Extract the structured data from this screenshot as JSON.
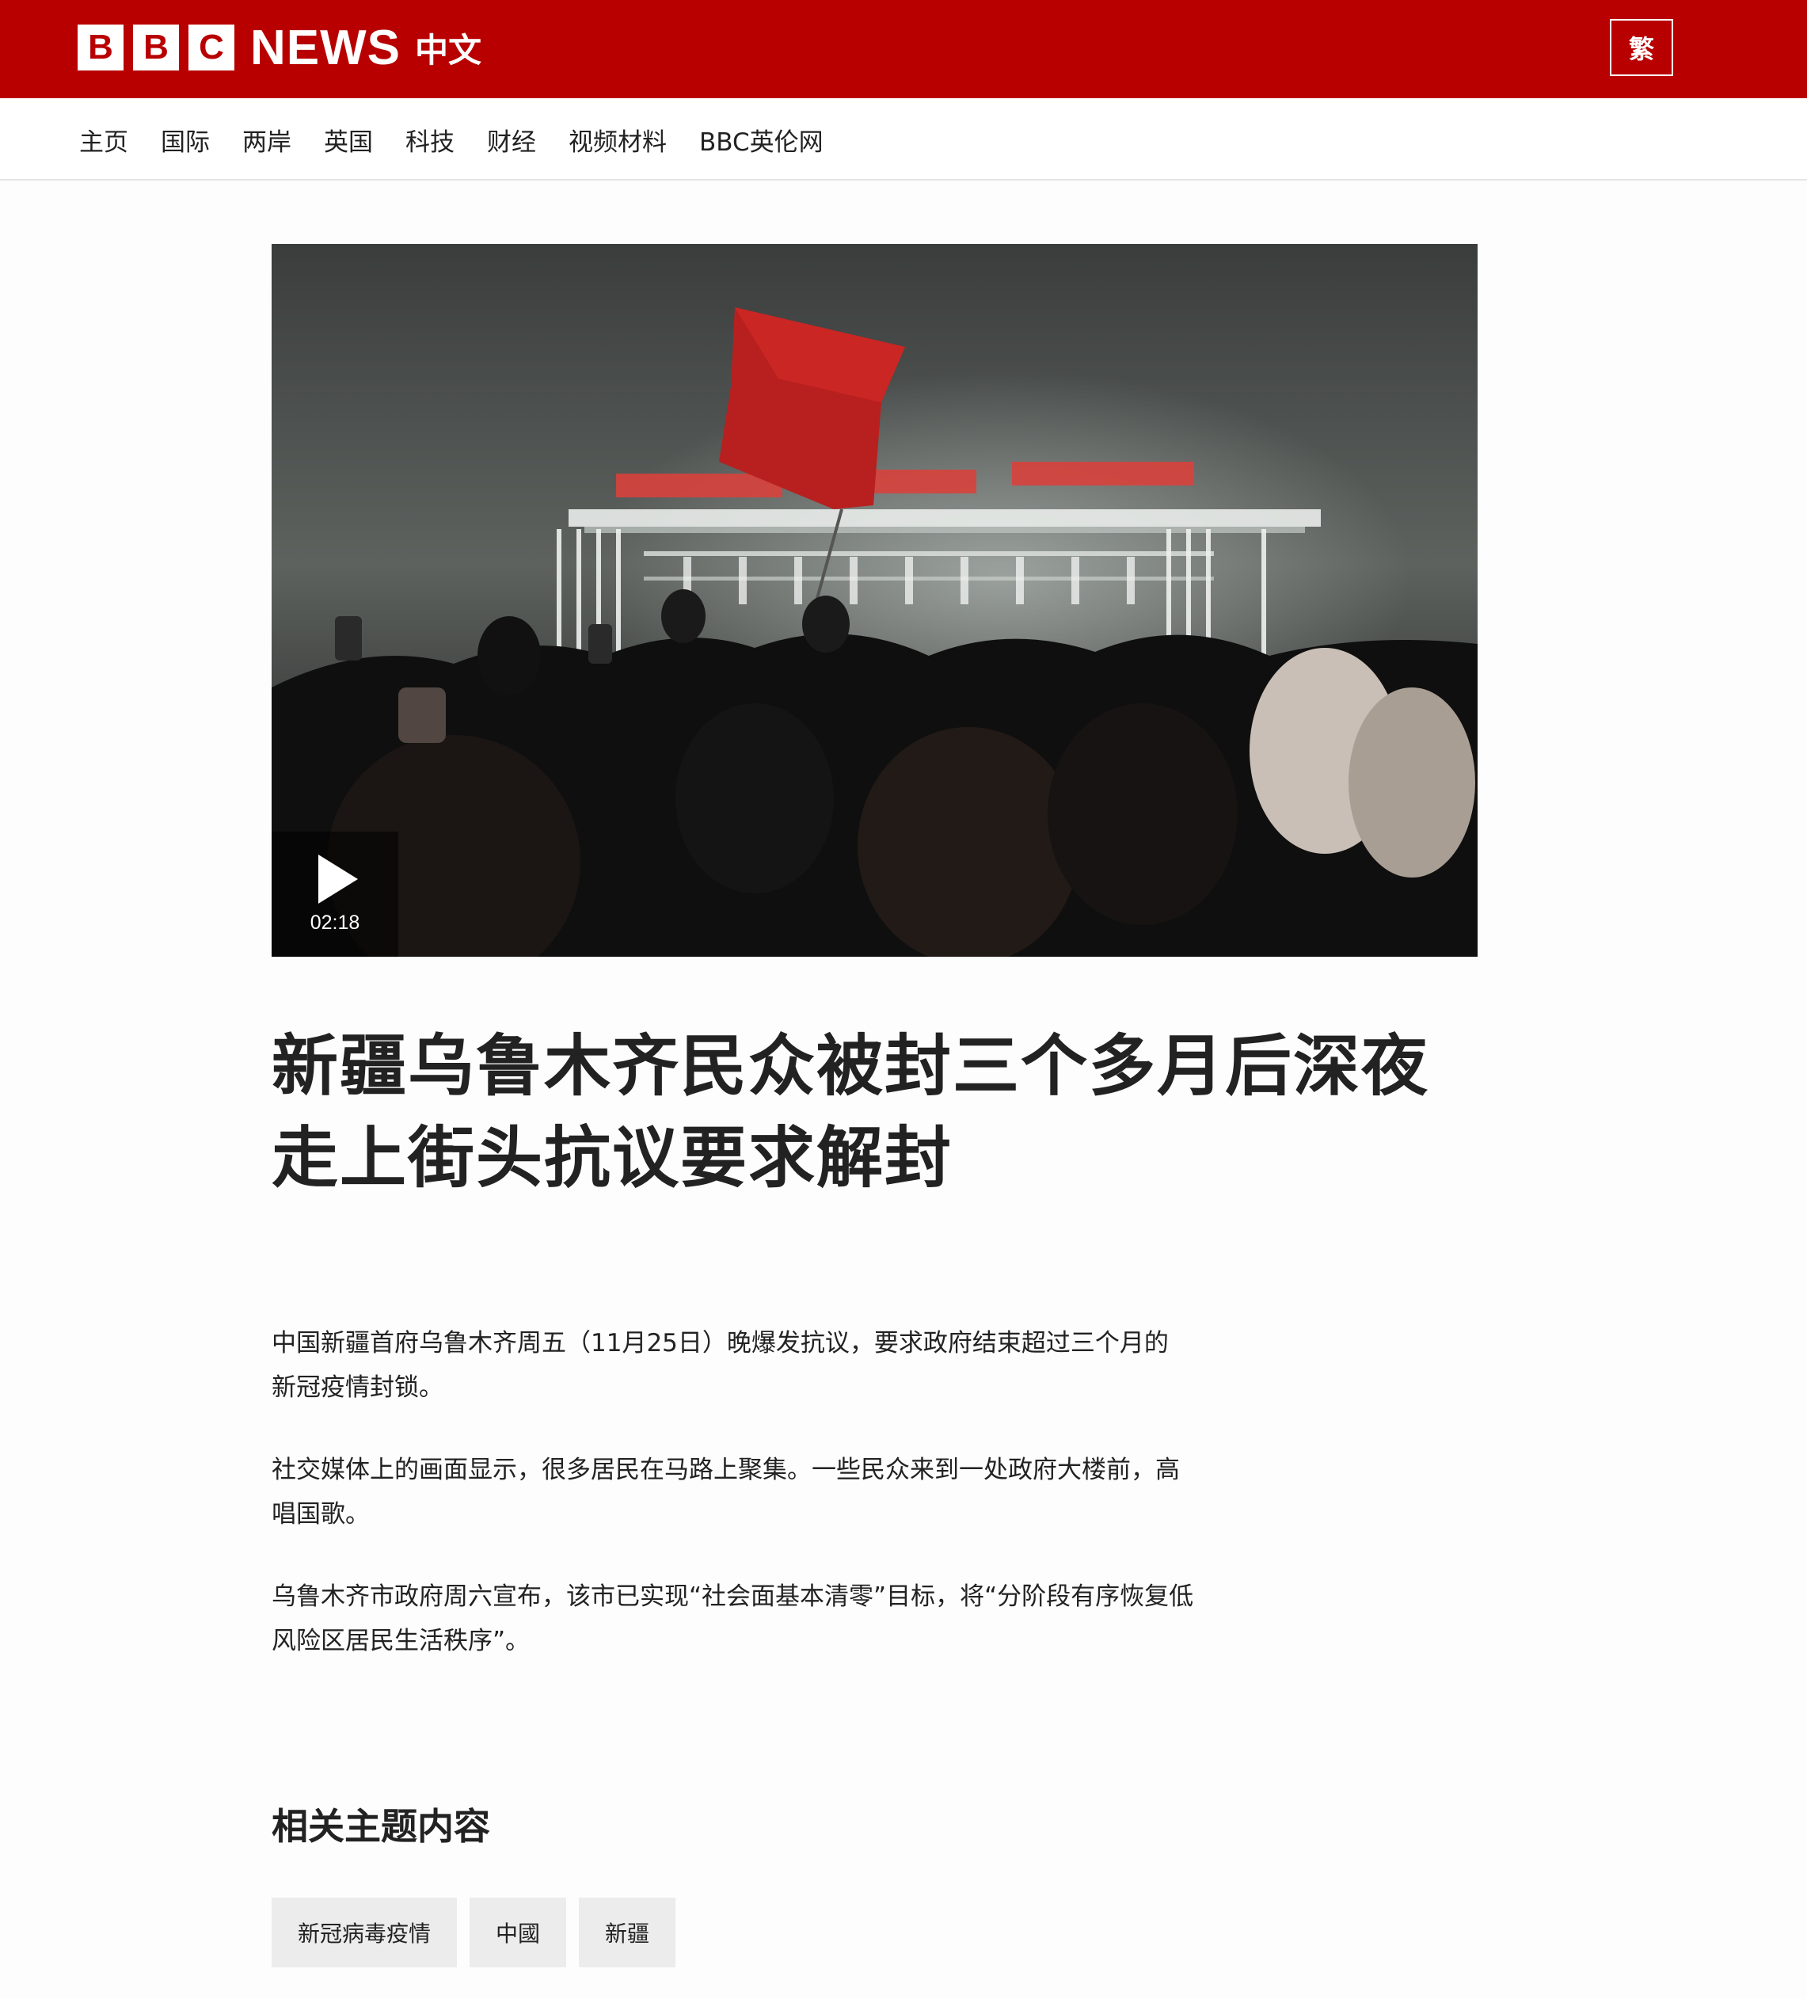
{
  "header": {
    "logo_letters": [
      "B",
      "B",
      "C"
    ],
    "logo_news": "NEWS",
    "logo_language": "中文",
    "script_switch_label": "繁",
    "brand_color": "#b80000"
  },
  "nav": {
    "items": [
      "主页",
      "国际",
      "两岸",
      "英国",
      "科技",
      "财经",
      "视频材料",
      "BBC英伦网"
    ]
  },
  "video": {
    "duration": "02:18",
    "play_icon": "play-icon"
  },
  "article": {
    "headline_line1": "新疆乌鲁木齐民众被封三个多月后深夜",
    "headline_line2": "走上街头抗议要求解封",
    "paragraphs": [
      {
        "line1": "中国新疆首府乌鲁木齐周五（11月25日）晚爆发抗议，要求政府结束超过三个月的",
        "line2": "新冠疫情封锁。"
      },
      {
        "line1": "社交媒体上的画面显示，很多居民在马路上聚集。一些民众来到一处政府大楼前，高",
        "line2": "唱国歌。"
      },
      {
        "line1": "乌鲁木齐市政府周六宣布，该市已实现“社会面基本清零”目标，将“分阶段有序恢复低",
        "line2": "风险区居民生活秩序”。"
      }
    ]
  },
  "related": {
    "title": "相关主题内容",
    "tags": [
      "新冠病毒疫情",
      "中國",
      "新疆"
    ]
  }
}
